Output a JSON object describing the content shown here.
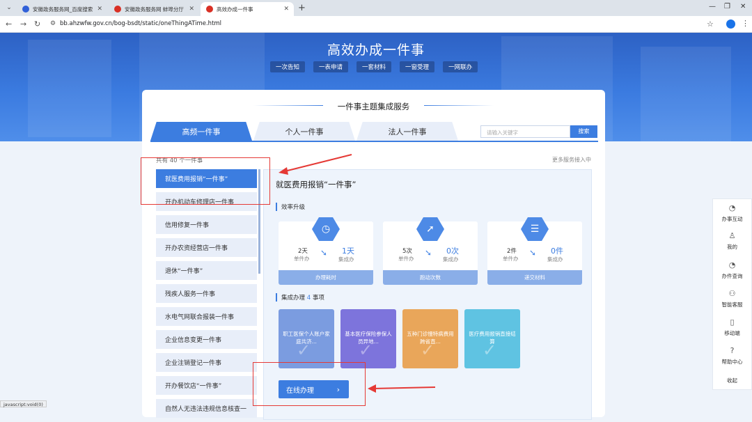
{
  "browser": {
    "tabs": [
      {
        "title": "安徽政务服务网_百度搜索",
        "color": "#3060d8"
      },
      {
        "title": "安徽政务服务网 蚌埠分厅",
        "color": "#d93025"
      },
      {
        "title": "高效办成一件事",
        "color": "#d93025"
      }
    ],
    "url": "bb.ahzwfw.gov.cn/bog-bsdt/static/oneThingATime.html",
    "status": "javascript:void(0)"
  },
  "banner": {
    "title": "高效办成一件事",
    "slogans": [
      "一次告知",
      "一表申请",
      "一套材料",
      "一窗受理",
      "一网联办"
    ]
  },
  "section_title": "一件事主题集成服务",
  "main_tabs": [
    "高频一件事",
    "个人一件事",
    "法人一件事"
  ],
  "search": {
    "placeholder": "请输入关键字",
    "button": "搜索"
  },
  "total_text": "共有 40 个一件事",
  "more_text": "更多服务接入中",
  "items": [
    "就医费用报销“一件事”",
    "开办机动车修理店一件事",
    "信用修复一件事",
    "开办农资经营店一件事",
    "退休“一件事”",
    "残疾人服务一件事",
    "水电气网联合报装一件事",
    "企业信息变更一件事",
    "企业注销登记一件事",
    "开办餐饮店“一件事”",
    "自然人无违法违规信息核查一"
  ],
  "detail": {
    "title": "就医费用报销“一件事”",
    "efficiency_label": "效率升级",
    "cards": [
      {
        "icon": "clock-icon",
        "before_val": "2天",
        "before_label": "单件办",
        "after_val": "1天",
        "after_label": "集成办",
        "footer": "办理耗时"
      },
      {
        "icon": "runner-icon",
        "before_val": "5次",
        "before_label": "单件办",
        "after_val": "0次",
        "after_label": "集成办",
        "footer": "跑动次数"
      },
      {
        "icon": "document-icon",
        "before_val": "2件",
        "before_label": "单件办",
        "after_val": "0件",
        "after_label": "集成办",
        "footer": "递交材料"
      }
    ],
    "integrated_prefix": "集成办理",
    "integrated_count": "4",
    "integrated_suffix": "事项",
    "matters": [
      {
        "text": "职工医保个人账户家庭共济...",
        "color": "#7b9ce0"
      },
      {
        "text": "基本医疗保险参保人员异地...",
        "color": "#7d74dc"
      },
      {
        "text": "五种门诊慢特病费用跨省直...",
        "color": "#e9a65a"
      },
      {
        "text": "医疗费用报销直接结算",
        "color": "#5fc3e2"
      }
    ],
    "online_button": "在线办理"
  },
  "side": [
    {
      "icon": "chat-icon",
      "label": "办事互动"
    },
    {
      "icon": "user-icon",
      "label": "我的"
    },
    {
      "icon": "query-icon",
      "label": "办件查询"
    },
    {
      "icon": "service-icon",
      "label": "智能客服"
    },
    {
      "icon": "mobile-icon",
      "label": "移动端"
    },
    {
      "icon": "help-icon",
      "label": "帮助中心"
    },
    {
      "icon": "",
      "label": "收起"
    }
  ]
}
